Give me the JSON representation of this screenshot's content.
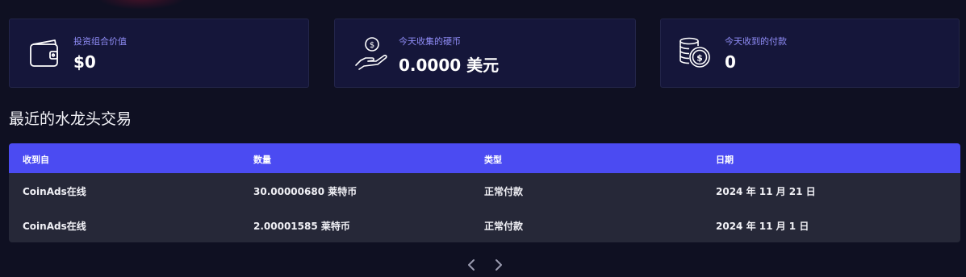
{
  "stats": [
    {
      "label": "投资组合价值",
      "value": "$0",
      "icon": "wallet-icon"
    },
    {
      "label": "今天收集的硬币",
      "value": "0.0000 美元",
      "icon": "hand-coin-icon"
    },
    {
      "label": "今天收到的付款",
      "value": "0",
      "icon": "coins-stack-icon"
    }
  ],
  "section_title": "最近的水龙头交易",
  "table": {
    "headers": [
      "收到自",
      "数量",
      "类型",
      "日期"
    ],
    "rows": [
      [
        "CoinAds在线",
        "30.00000680 莱特币",
        "正常付款",
        "2024 年 11 月 21 日"
      ],
      [
        "CoinAds在线",
        "2.00001585 莱特币",
        "正常付款",
        "2024 年 11 月 1 日"
      ]
    ]
  },
  "pagination": {
    "prev": "‹",
    "next": "›"
  },
  "colors": {
    "background": "#0f1022",
    "card": "#15163a",
    "accent": "#4b4bf2",
    "label": "#8f8cf6",
    "table_body": "#262838"
  }
}
